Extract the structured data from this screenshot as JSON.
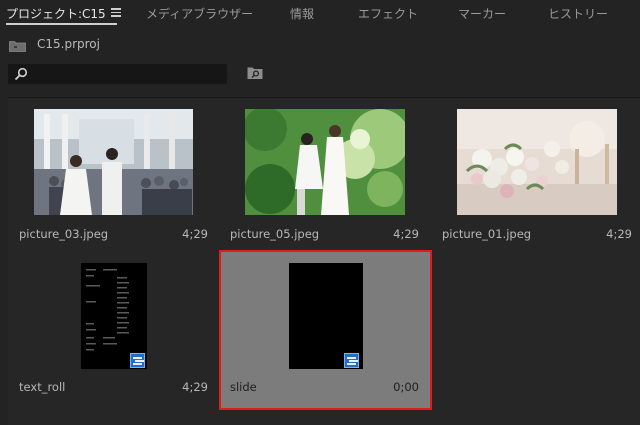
{
  "tabs": [
    {
      "label": "プロジェクト:C15",
      "active": true
    },
    {
      "label": "メディアブラウザー",
      "active": false
    },
    {
      "label": "情報",
      "active": false
    },
    {
      "label": "エフェクト",
      "active": false
    },
    {
      "label": "マーカー",
      "active": false
    },
    {
      "label": "ヒストリー",
      "active": false
    }
  ],
  "project": {
    "filename": "C15.prproj"
  },
  "search": {
    "value": "",
    "placeholder": ""
  },
  "items": [
    {
      "name": "picture_03.jpeg",
      "duration": "4;29",
      "type": "image"
    },
    {
      "name": "picture_05.jpeg",
      "duration": "4;29",
      "type": "image"
    },
    {
      "name": "picture_01.jpeg",
      "duration": "4;29",
      "type": "image"
    },
    {
      "name": "text_roll",
      "duration": "4;29",
      "type": "sequence"
    },
    {
      "name": "slide",
      "duration": "0;00",
      "type": "sequence",
      "selected": true
    }
  ],
  "colors": {
    "selection_border": "#e51b1b",
    "sequence_badge": "#1f6fc7"
  }
}
